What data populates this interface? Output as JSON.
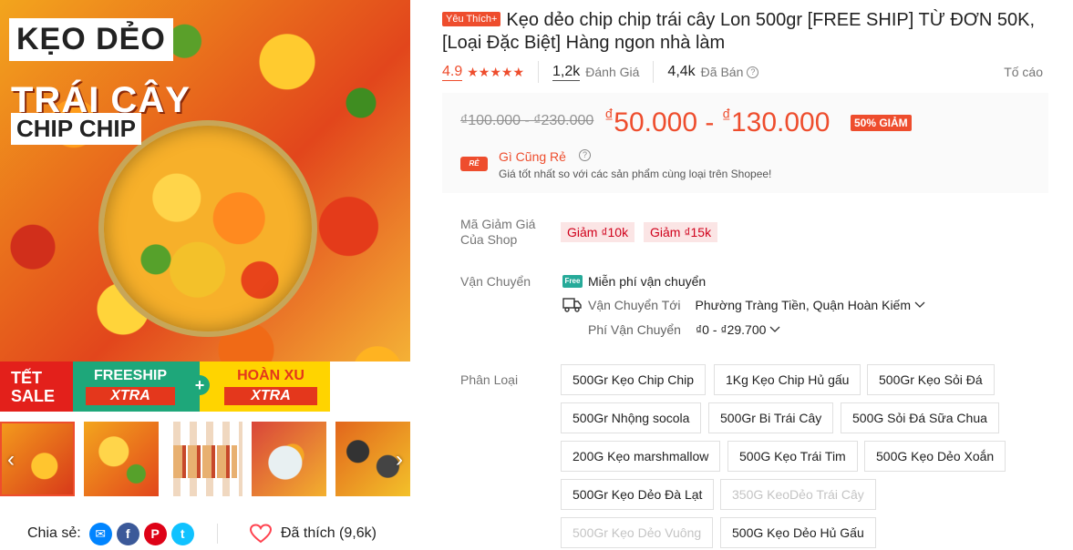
{
  "gallery": {
    "main_image_text": {
      "line1": "KẸO DẺO",
      "line2": "TRÁI CÂY",
      "line3": "CHIP CHIP"
    },
    "promo": {
      "tet": "TẾT SALE",
      "freeship": "FREESHIP",
      "freeship_xtra": "XTRA",
      "plus": "+",
      "hoanxu": "HOÀN XU",
      "hoanxu_xtra": "XTRA"
    },
    "arrows": {
      "prev": "‹",
      "next": "›"
    }
  },
  "share": {
    "label": "Chia sẻ:",
    "networks": [
      "messenger-icon",
      "facebook-icon",
      "pinterest-icon",
      "twitter-icon"
    ],
    "messenger_glyph": "✉",
    "facebook_glyph": "f",
    "pinterest_glyph": "P",
    "twitter_glyph": "t"
  },
  "like": {
    "label": "Đã thích (9,6k)"
  },
  "product": {
    "badge": "Yêu Thích+",
    "title": "Kẹo dẻo chip chip trái cây Lon 500gr [FREE SHIP] TỪ ĐƠN 50K, [Loại Đặc Biệt] Hàng ngon nhà làm"
  },
  "stats": {
    "rating": "4.9",
    "stars": "★★★★★",
    "reviews_count": "1,2k",
    "reviews_label": "Đánh Giá",
    "sold_count": "4,4k",
    "sold_label": "Đã Bán",
    "help": "?",
    "report": "Tố cáo"
  },
  "price": {
    "old": "₫100.000 - ₫230.000",
    "currency": "₫",
    "new_low": "50.000",
    "dash": " - ",
    "new_high": "130.000",
    "discount": "50% GIẢM",
    "cheap_logo": "RẺ",
    "cheap_title": "Gì Cũng Rẻ",
    "cheap_help": "?",
    "cheap_desc": "Giá tốt nhất so với các sản phẩm cùng loại trên Shopee!"
  },
  "vouchers": {
    "label": "Mã Giảm Giá Của Shop",
    "items": [
      "Giảm ₫10k",
      "Giảm ₫15k"
    ]
  },
  "shipping": {
    "label": "Vận Chuyển",
    "free_badge": "Free",
    "free_text": "Miễn phí vận chuyển",
    "to_label": "Vận Chuyển Tới",
    "to_value": "Phường Tràng Tiền, Quận Hoàn Kiếm",
    "fee_label": "Phí Vận Chuyển",
    "fee_value": "₫0 - ₫29.700"
  },
  "variants": {
    "label": "Phân Loại",
    "items": [
      {
        "label": "500Gr Kẹo Chip Chip",
        "disabled": false
      },
      {
        "label": "1Kg Kẹo Chip Hủ gấu",
        "disabled": false
      },
      {
        "label": "500Gr Kẹo Sỏi Đá",
        "disabled": false
      },
      {
        "label": "500Gr Nhộng socola",
        "disabled": false
      },
      {
        "label": "500Gr Bi Trái Cây",
        "disabled": false
      },
      {
        "label": "500G Sỏi Đá Sữa Chua",
        "disabled": false
      },
      {
        "label": "200G Kẹo marshmallow",
        "disabled": false
      },
      {
        "label": "500G Kẹo Trái Tim",
        "disabled": false
      },
      {
        "label": "500G Kẹo Dẻo Xoắn",
        "disabled": false
      },
      {
        "label": "500Gr Kẹo Dẻo Đà Lạt",
        "disabled": false
      },
      {
        "label": "350G KeoDẻo Trái Cây",
        "disabled": true
      },
      {
        "label": "500Gr Kẹo Dẻo Vuông",
        "disabled": true
      },
      {
        "label": "500G Kẹo Dẻo Hủ Gấu",
        "disabled": false
      }
    ]
  },
  "colors": {
    "accent": "#ee4d2d",
    "price_bg": "#fafafa",
    "voucher_bg": "#fbe5e5",
    "voucher_text": "#d0011b",
    "free_ship": "#26aa99"
  }
}
